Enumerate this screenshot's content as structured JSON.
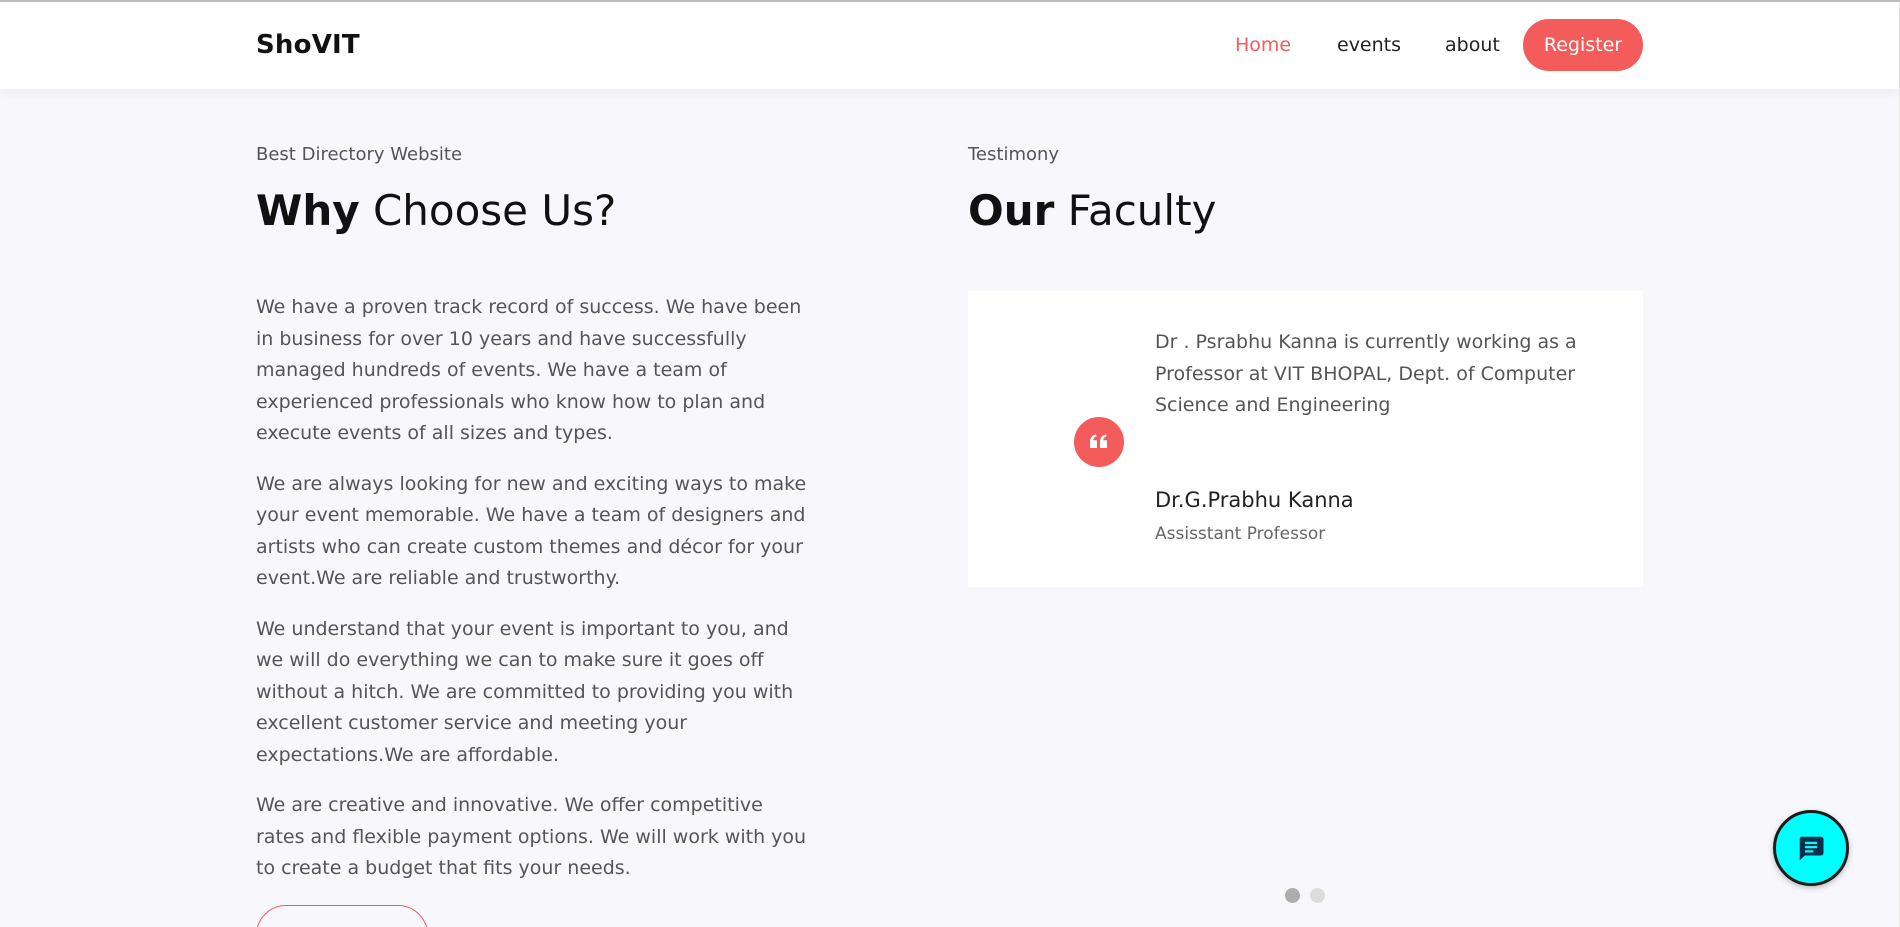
{
  "brand": {
    "name": "ShoVIT",
    "accent_color": "#f45b5b",
    "chat_color": "#00ffff"
  },
  "nav": {
    "items": [
      {
        "label": "Home",
        "active": true
      },
      {
        "label": "events",
        "active": false
      },
      {
        "label": "about",
        "active": false
      }
    ],
    "register_label": "Register"
  },
  "why_section": {
    "eyebrow": "Best Directory Website",
    "title_bold": "Why",
    "title_rest": " Choose Us?",
    "paragraphs": [
      "We have a proven track record of success. We have been in business for over 10 years and have successfully managed hundreds of events. We have a team of experienced professionals who know how to plan and execute events of all sizes and types.",
      "We are always looking for new and exciting ways to make your event memorable. We have a team of designers and artists who can create custom themes and décor for your event.We are reliable and trustworthy.",
      "We understand that your event is important to you, and we will do everything we can to make sure it goes off without a hitch. We are committed to providing you with excellent customer service and meeting your expectations.We are affordable.",
      "We are creative and innovative. We offer competitive rates and flexible payment options. We will work with you to create a budget that fits your needs."
    ]
  },
  "faculty_section": {
    "eyebrow": "Testimony",
    "title_bold": "Our",
    "title_rest": " Faculty",
    "testimonial": {
      "quote_icon": "quote-icon",
      "text": "Dr . Psrabhu Kanna is currently working as a Professor at VIT BHOPAL, Dept. of Computer Science and Engineering",
      "name": "Dr.G.Prabhu Kanna",
      "role": "Assisstant Professor"
    },
    "carousel": {
      "slides": 2,
      "active_index": 0
    }
  },
  "chat_widget": {
    "icon": "chat-bubble-icon"
  }
}
